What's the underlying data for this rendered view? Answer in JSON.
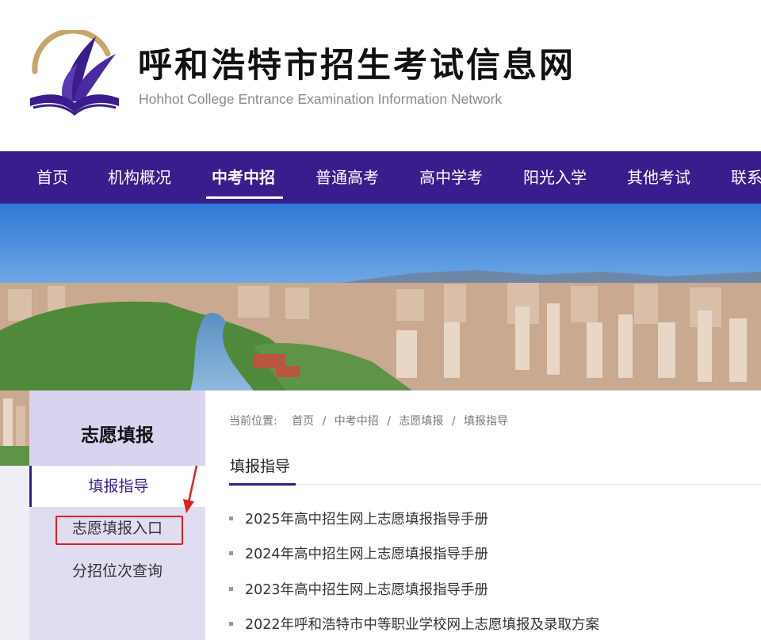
{
  "header": {
    "title": "呼和浩特市招生考试信息网",
    "subtitle": "Hohhot College Entrance Examination Information Network"
  },
  "nav": {
    "items": [
      "首页",
      "机构概况",
      "中考中招",
      "普通高考",
      "高中学考",
      "阳光入学",
      "其他考试",
      "联系"
    ],
    "active": "中考中招"
  },
  "sidebar": {
    "title": "志愿填报",
    "items": [
      "填报指导",
      "志愿填报入口",
      "分招位次查询"
    ]
  },
  "breadcrumb": {
    "label": "当前位置:",
    "items": [
      "首页",
      "中考中招",
      "志愿填报",
      "填报指导"
    ],
    "separator": "/"
  },
  "section": {
    "title": "填报指导"
  },
  "articles": [
    "2025年高中招生网上志愿填报指导手册",
    "2024年高中招生网上志愿填报指导手册",
    "2023年高中招生网上志愿填报指导手册",
    "2022年呼和浩特市中等职业学校网上志愿填报及录取方案"
  ],
  "colors": {
    "brand_purple": "#3a1d8c",
    "sidebar_bg": "#e1ddf1",
    "annotation_red": "#e02020",
    "logo_gold": "#c7a56b"
  }
}
